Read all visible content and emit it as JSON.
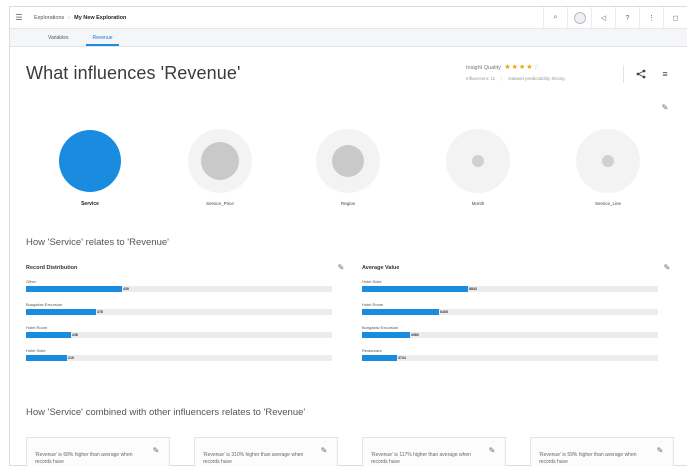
{
  "topbar": {
    "breadcrumb": [
      "Explorations",
      "My New Exploration"
    ],
    "icons": [
      "search-icon",
      "avatar",
      "megaphone-icon",
      "help-icon",
      "more-vertical-icon",
      "chat-icon"
    ]
  },
  "tabs": [
    {
      "label": "Variables",
      "active": false
    },
    {
      "label": "Revenue",
      "active": true
    }
  ],
  "header": {
    "title": "What influences 'Revenue'",
    "quality_label": "Insight Quality",
    "stars_filled": "★★★★",
    "stars_empty": "☆",
    "quality_rating": 4,
    "quality_max": 5,
    "influencers_text": "Influencers: 11",
    "predictability_text": "Dataset predictability Strong"
  },
  "influencers": [
    {
      "label": "Service",
      "selected": true,
      "color": "#1a8ce0"
    },
    {
      "label": "Service_Price",
      "selected": false,
      "color": "#c9c9c9"
    },
    {
      "label": "Region",
      "selected": false,
      "color": "#c9c9c9"
    },
    {
      "label": "Month",
      "selected": false,
      "color": "#d6d6d6"
    },
    {
      "label": "Service_Line",
      "selected": false,
      "color": "#d6d6d6"
    }
  ],
  "relates_heading": "How 'Service' relates to 'Revenue'",
  "record_distribution": {
    "title": "Record Distribution",
    "rows": [
      {
        "label": "Other",
        "value": "439",
        "fraction": 1.0
      },
      {
        "label": "Bungalow Excursion",
        "value": "378",
        "fraction": 0.73
      },
      {
        "label": "Hotel Room",
        "value": "238",
        "fraction": 0.47
      },
      {
        "label": "Hotel Suite",
        "value": "219",
        "fraction": 0.43
      }
    ]
  },
  "average_value": {
    "title": "Average Value",
    "rows": [
      {
        "label": "Hotel Suite",
        "value": "8843",
        "fraction": 1.0
      },
      {
        "label": "Hotel Room",
        "value": "6408",
        "fraction": 0.73
      },
      {
        "label": "Bungalow Excursion",
        "value": "3980",
        "fraction": 0.45
      },
      {
        "label": "Restaurant",
        "value": "3734",
        "fraction": 0.33
      }
    ]
  },
  "combined_heading": "How 'Service' combined with other influencers relates to 'Revenue'",
  "cards": [
    {
      "text": "'Revenue' is 68% higher than average when records have"
    },
    {
      "text": "'Revenue' is 310% higher than average when records have"
    },
    {
      "text": "'Revenue' is 117% higher than average when records have"
    },
    {
      "text": "'Revenue' is 59% higher than average when records have"
    }
  ],
  "colors": {
    "accent": "#1a8ce0",
    "star": "#f2a300"
  }
}
